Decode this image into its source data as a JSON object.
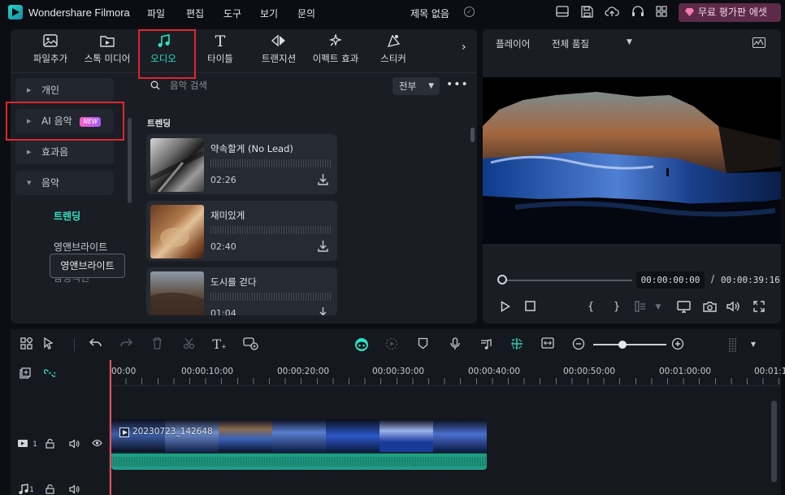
{
  "app": {
    "title": "Wondershare Filmora",
    "menu": [
      "파일",
      "편집",
      "도구",
      "보기",
      "문의"
    ],
    "project_title": "제목 없음",
    "trial_button": "무료 평가판 에셋"
  },
  "media_tabs": {
    "items": [
      {
        "label": "파일추가",
        "icon": "image-add-icon"
      },
      {
        "label": "스톡 미디어",
        "icon": "stock-media-icon"
      },
      {
        "label": "오디오",
        "icon": "music-note-icon",
        "active": true
      },
      {
        "label": "타이틀",
        "icon": "text-t-icon"
      },
      {
        "label": "트랜지션",
        "icon": "transition-icon"
      },
      {
        "label": "이펙트 효과",
        "icon": "effects-sparkle-icon"
      },
      {
        "label": "스티커",
        "icon": "sticker-icon"
      }
    ],
    "more": "›"
  },
  "categories": {
    "items": [
      {
        "label": "개인"
      },
      {
        "label": "AI 음악",
        "badge": "NEW"
      },
      {
        "label": "효과음"
      },
      {
        "label": "음악",
        "expanded": true
      }
    ],
    "sub_items": [
      "트렌딩",
      "영앤브라이트",
      "감성적인"
    ],
    "tooltip": "영앤브라이트"
  },
  "search": {
    "placeholder": "음악 검색",
    "filter": "전부"
  },
  "music_list": {
    "section_title": "트렌딩",
    "tracks": [
      {
        "title": "약속할게 (No Lead)",
        "duration": "02:26"
      },
      {
        "title": "재미있게",
        "duration": "02:40"
      },
      {
        "title": "도시를 걷다",
        "duration": "01:04"
      }
    ]
  },
  "player": {
    "label": "플레이어",
    "quality": "전체 품질",
    "current_time": "00:00:00:00",
    "separator": "/",
    "total_time": "00:00:39:16"
  },
  "timeline": {
    "ruler": [
      "00:00",
      "00:00:10:00",
      "00:00:20:00",
      "00:00:30:00",
      "00:00:40:00",
      "00:00:50:00",
      "00:01:00:00",
      "00:01:1"
    ],
    "clip_name": "20230723_142648",
    "video_track_number": "1",
    "audio_track_number": "1"
  },
  "colors": {
    "accent": "#2de3c6",
    "highlight_box": "#e0262e",
    "playhead": "#e8505b",
    "trial_bg": "#5d2b49",
    "audio_clip": "#1f9e86"
  }
}
